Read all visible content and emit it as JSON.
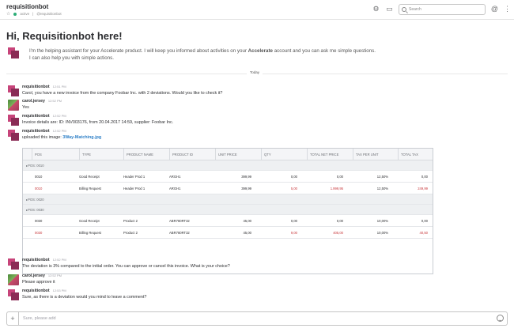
{
  "header": {
    "channel_name": "requisitionbot",
    "status": "active",
    "handle": "@requisitionbot",
    "search_placeholder": "Search",
    "icons": [
      "gear-icon",
      "sidebar-icon",
      "search-icon",
      "mention-icon",
      "more-icon"
    ]
  },
  "intro": {
    "title": "Hi, Requisitionbot here!",
    "line1_pre": "I'm the helping assistant for your Accelerate product. I will keep you informed about activities on your ",
    "line1_bold": "Accelerate",
    "line1_post": " account and you can ask me simple questions.",
    "line2": "I can also help you with simple actions."
  },
  "day_divider": "Today",
  "messages": [
    {
      "author": "requisitionbot",
      "time": "12:51 PM",
      "text": "Carol, you have a new invoice from the company Foobar Inc. with 2 deviations. Would you like to check it?"
    },
    {
      "author": "carol.jersey",
      "time": "12:52 PM",
      "text": "Yes"
    },
    {
      "author": "requisitionbot",
      "time": "12:52 PM",
      "text": "Invoice details are: ID: INV003176, from 20.04.2017 14:59, supplier: Foobar Inc."
    },
    {
      "author": "requisitionbot",
      "time": "12:52 PM",
      "text_pre": "uploaded this image: ",
      "link": "3Way-Matching.jpg"
    },
    {
      "author": "requisitionbot",
      "time": "12:52 PM",
      "text": "The deviation is 3% compared to the initial order. You can approve or cancel this invoice. What is your choice?"
    },
    {
      "author": "carol.jersey",
      "time": "12:52 PM",
      "text": "Please approve it"
    },
    {
      "author": "requisitionbot",
      "time": "12:53 PM",
      "text": "Sure, as there is a deviation would you mind to leave a comment?"
    }
  ],
  "table": {
    "headers": [
      "POS",
      "TYPE",
      "PRODUCT NAME",
      "PRODUCT ID",
      "UNIT PRICE",
      "QTY",
      "TOTAL NET PRICE",
      "TAX PER UNIT",
      "TOTAL TAX"
    ],
    "groups": [
      {
        "label": "POS: 0010",
        "rows": [
          {
            "pos": "0010",
            "type": "Good Receipt",
            "name": "Header Prod 1",
            "id": "ARGH1",
            "unit": "399,99",
            "qty": "0,00",
            "net": "0,00",
            "taxu": "12,50%",
            "tax": "0,00",
            "red": false
          },
          {
            "pos": "0010",
            "type": "Billing Request",
            "name": "Header Prod 1",
            "id": "ARGH1",
            "unit": "399,99",
            "qty": "5,00",
            "net": "1.999,95",
            "taxu": "12,50%",
            "tax": "249,99",
            "red": true
          }
        ]
      },
      {
        "label": "POS: 0020",
        "rows": []
      },
      {
        "label": "POS: 0030",
        "rows": [
          {
            "pos": "0030",
            "type": "Good Receipt",
            "name": "Product 2",
            "id": "ABR780RT32",
            "unit": "45,00",
            "qty": "0,00",
            "net": "0,00",
            "taxu": "10,00%",
            "tax": "0,00",
            "red": false
          },
          {
            "pos": "0030",
            "type": "Billing Request",
            "name": "Product 2",
            "id": "ABR780RT32",
            "unit": "45,00",
            "qty": "9,00",
            "net": "405,00",
            "taxu": "10,00%",
            "tax": "40,50",
            "red": true
          }
        ]
      }
    ]
  },
  "composer": {
    "placeholder": "Sure, please add"
  }
}
